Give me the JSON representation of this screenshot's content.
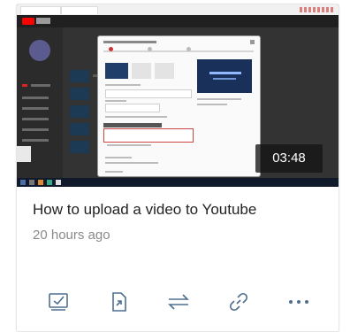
{
  "video": {
    "title": "How to upload a video to Youtube",
    "posted": "20 hours ago",
    "duration": "03:48"
  },
  "actions": [
    {
      "icon": "checkbox-icon"
    },
    {
      "icon": "share-arrow-icon"
    },
    {
      "icon": "swap-arrows-icon"
    },
    {
      "icon": "link-icon"
    },
    {
      "icon": "more-icon"
    }
  ],
  "colors": {
    "icon": "#4f6f8f",
    "title": "#222222",
    "meta": "#8a8a8a"
  }
}
